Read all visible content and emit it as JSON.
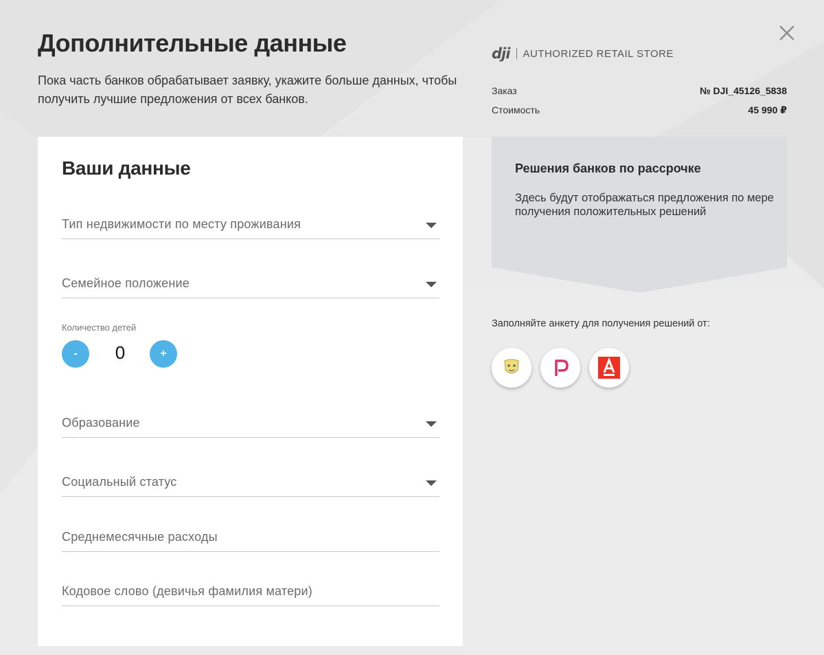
{
  "page": {
    "title": "Дополнительные данные",
    "subtitle": "Пока часть банков обрабатывает заявку, укажите больше данных, чтобы получить лучшие предложения от всех банков."
  },
  "form": {
    "title": "Ваши данные",
    "property_type": "Тип недвижимости по месту проживания",
    "marital_status": "Семейное положение",
    "children_label": "Количество детей",
    "children_minus": "-",
    "children_value": "0",
    "children_plus": "+",
    "education": "Образование",
    "social_status": "Социальный статус",
    "monthly_expenses": "Среднемесячные расходы",
    "code_word": "Кодовое слово (девичья фамилия матери)"
  },
  "store": {
    "logo": "dji",
    "name": "AUTHORIZED RETAIL STORE"
  },
  "order": {
    "number_label": "Заказ",
    "number_value": "№ DJI_45126_5838",
    "price_label": "Стоимость",
    "price_value": "45 990 ₽"
  },
  "offers": {
    "title": "Решения банков по рассрочке",
    "text": "Здесь будут отображаться предложения по мере получения положительных решений"
  },
  "banks": {
    "note": "Заполняйте анкету для получения решений от:",
    "items": [
      "tinkoff-bank-icon",
      "renaissance-bank-icon",
      "alfa-bank-icon"
    ]
  },
  "colors": {
    "accent": "#4fb3e8",
    "offers_bg": "#dcdde1",
    "alfa_red": "#ef3124",
    "renaissance_pink": "#d6336c"
  }
}
